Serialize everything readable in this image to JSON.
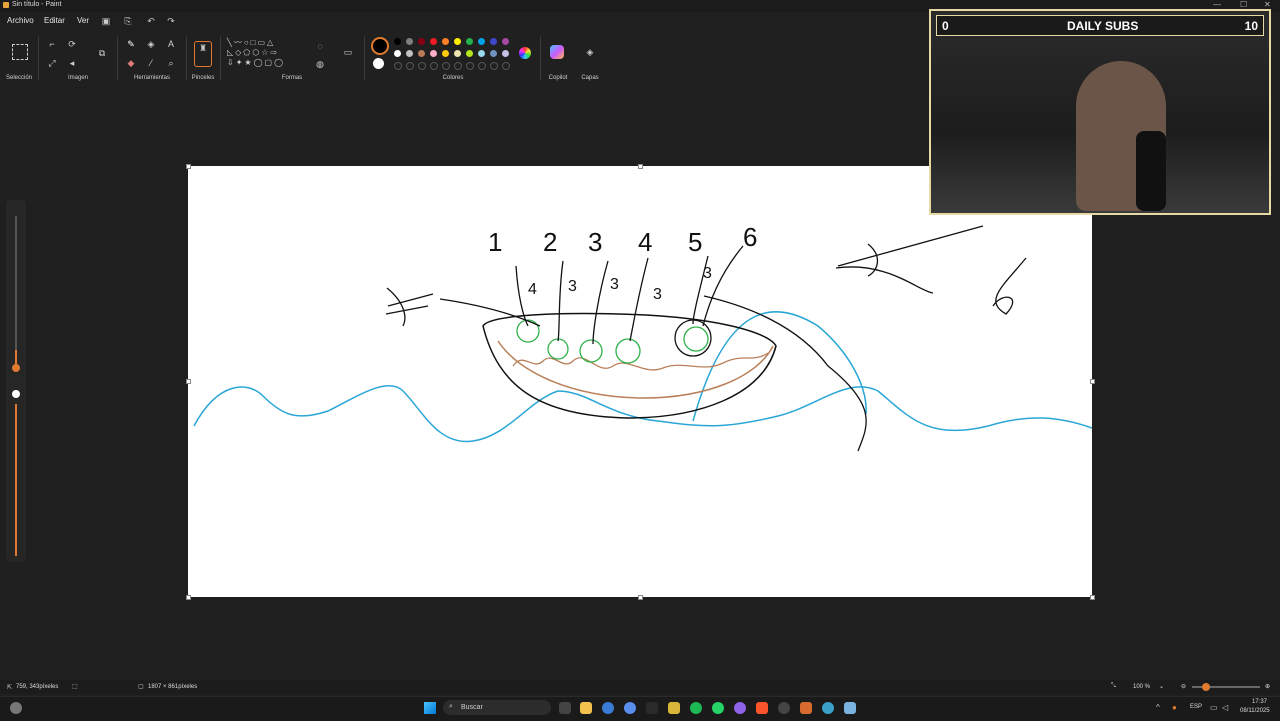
{
  "window": {
    "title": "Sin título - Paint"
  },
  "menu": {
    "file": "Archivo",
    "edit": "Editar",
    "view": "Ver"
  },
  "ribbon": {
    "selection_label": "Selección",
    "image_label": "Imagen",
    "tools_label": "Herramientas",
    "brushes_label": "Pinceles",
    "shapes_label": "Formas",
    "colors_label": "Colores",
    "copilot_label": "Copilot",
    "layers_label": "Capas"
  },
  "palette": {
    "row1": [
      "#000000",
      "#7f7f7f",
      "#880015",
      "#ed1c24",
      "#ff7f27",
      "#fff200",
      "#22b14c",
      "#00a2e8",
      "#3f48cc",
      "#a349a4"
    ],
    "row2": [
      "#ffffff",
      "#c3c3c3",
      "#b97a57",
      "#ffaec9",
      "#ffc90e",
      "#efe4b0",
      "#b5e61d",
      "#99d9ea",
      "#7092be",
      "#c8bfe7"
    ],
    "primary": "#000000",
    "secondary": "#ffffff"
  },
  "status": {
    "cursor_pos": "759, 343píxeles",
    "canvas_size": "1807 × 861píxeles",
    "zoom": "100 %"
  },
  "taskbar": {
    "search_placeholder": "Buscar",
    "lang": "ESP",
    "time": "17:37",
    "date": "08/11/2025"
  },
  "overlay": {
    "left_count": "0",
    "title": "DAILY SUBS",
    "right_count": "10"
  },
  "drawing": {
    "numbers_top": [
      "1",
      "2",
      "3",
      "4",
      "5",
      "6"
    ],
    "numbers_lower": [
      "4",
      "3",
      "3",
      "3",
      "3"
    ]
  },
  "colors": {
    "accent": "#e07a2e",
    "water": "#2aa6d6",
    "fruit": "#2fb24a",
    "basket": "#b9805a"
  }
}
